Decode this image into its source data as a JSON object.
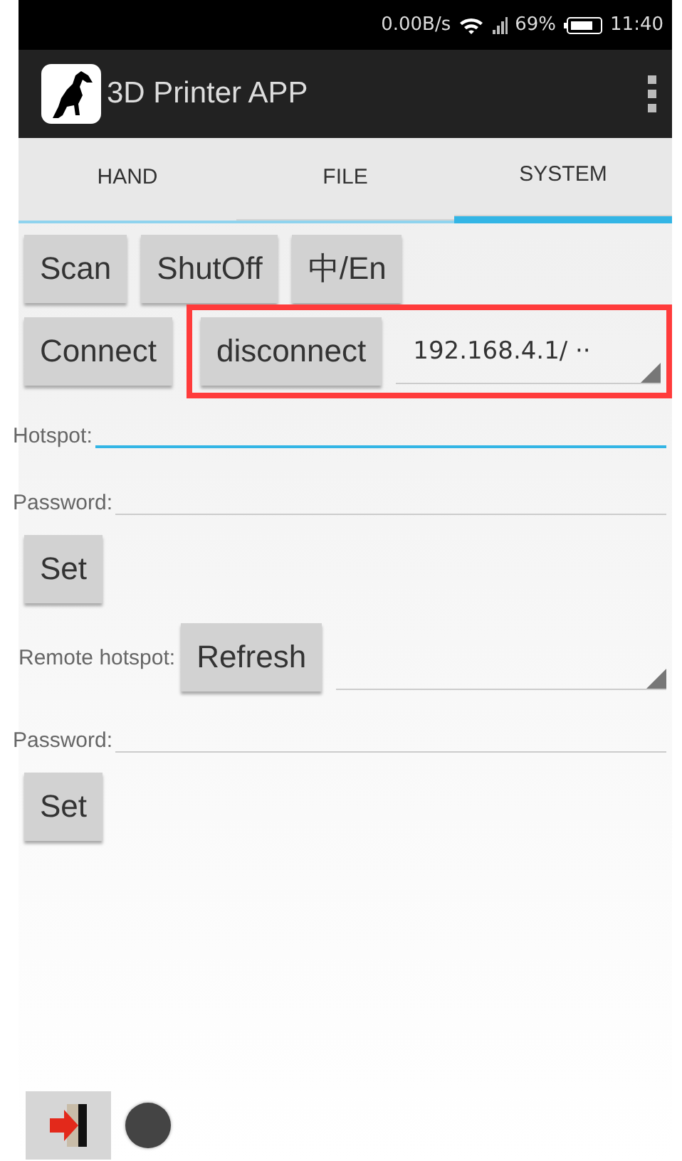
{
  "status_bar": {
    "net_speed": "0.00B/s",
    "battery": "69%",
    "time": "11:40"
  },
  "app_bar": {
    "title": "3D Printer APP"
  },
  "tabs": [
    {
      "label": "HAND",
      "selected": false
    },
    {
      "label": "FILE",
      "selected": false
    },
    {
      "label": "SYSTEM",
      "selected": true
    }
  ],
  "top_buttons": [
    "Scan",
    "ShutOff",
    "中/En"
  ],
  "connection": {
    "connect": "Connect",
    "disconnect": "disconnect",
    "address": "192.168.4.1/ ··",
    "highlighted": true
  },
  "hotspot": {
    "label": "Hotspot:",
    "focused": true
  },
  "password": {
    "label": "Password:"
  },
  "set_button": "Set",
  "remote": {
    "label": "Remote hotspot:",
    "refresh": "Refresh"
  },
  "remote_password": {
    "label": "Password:"
  },
  "remote_set_button": "Set",
  "footer": {
    "connected": false
  }
}
